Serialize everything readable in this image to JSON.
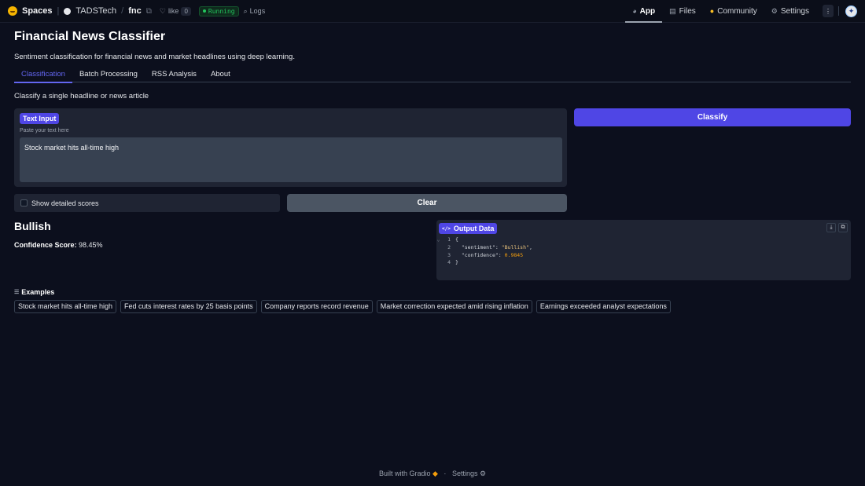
{
  "topbar": {
    "brand": "Spaces",
    "owner": "TADSTech",
    "separator": "/",
    "repo": "fnc",
    "like_label": "like",
    "like_count": "0",
    "status": "Running",
    "logs": "Logs",
    "nav": [
      {
        "label": "App",
        "icon": "app-icon",
        "active": true
      },
      {
        "label": "Files",
        "icon": "files-icon",
        "active": false
      },
      {
        "label": "Community",
        "icon": "community-icon",
        "active": false
      },
      {
        "label": "Settings",
        "icon": "settings-icon",
        "active": false
      }
    ]
  },
  "app": {
    "title": "Financial News Classifier",
    "subtitle": "Sentiment classification for financial news and market headlines using deep learning.",
    "tabs": [
      "Classification",
      "Batch Processing",
      "RSS Analysis",
      "About"
    ],
    "active_tab": "Classification",
    "section_desc": "Classify a single headline or news article"
  },
  "input": {
    "label": "Text Input",
    "hint": "Paste your text here",
    "value": "Stock market hits all-time high"
  },
  "buttons": {
    "classify": "Classify",
    "clear": "Clear"
  },
  "checkbox": {
    "label": "Show detailed scores",
    "checked": false
  },
  "result": {
    "sentiment": "Bullish",
    "confidence_label": "Confidence Score:",
    "confidence_value": "98.45%"
  },
  "output": {
    "label": "Output Data",
    "lines": [
      {
        "n": "1",
        "text": "{"
      },
      {
        "n": "2",
        "key": "\"sentiment\"",
        "value": "\"Bullish\"",
        "trail": ","
      },
      {
        "n": "3",
        "key": "\"confidence\"",
        "value": "0.9845",
        "trail": ""
      },
      {
        "n": "4",
        "text": "}"
      }
    ]
  },
  "examples": {
    "label": "Examples",
    "items": [
      "Stock market hits all-time high",
      "Fed cuts interest rates by 25 basis points",
      "Company reports record revenue",
      "Market correction expected amid rising inflation",
      "Earnings exceeded analyst expectations"
    ]
  },
  "footer": {
    "built_with": "Built with Gradio",
    "dot": "·",
    "settings": "Settings"
  },
  "colors": {
    "background": "#0c0f1d",
    "panel": "#1f2433",
    "accent": "#4f46e5",
    "tab_active": "#6366f1",
    "running": "#22c55e"
  }
}
